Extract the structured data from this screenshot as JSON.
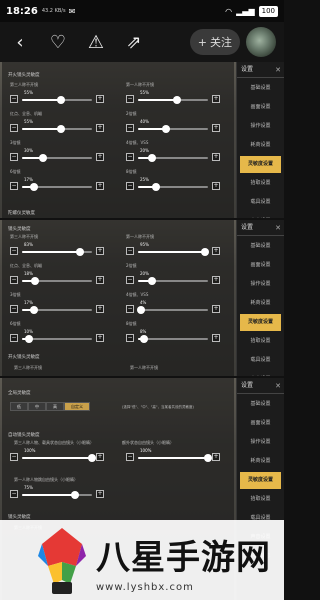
{
  "status": {
    "time": "18:26",
    "speed": "43.2 KB/s",
    "battery": "100"
  },
  "topbar": {
    "follow_label": "关注"
  },
  "sidebar": {
    "title": "设置",
    "items": [
      "基础设置",
      "画面设置",
      "操作设置",
      "耗商设置",
      "灵敏度设置",
      "拾取设置",
      "载具设置",
      "声音设置",
      "快速消息"
    ]
  },
  "panel1": {
    "section_a": "开火镜头灵敏度",
    "rows": [
      {
        "left": {
          "label": "第三人称不开镜",
          "pct": "55%",
          "value": 0.55
        },
        "right": {
          "label": "第一人称不开镜",
          "pct": "55%",
          "value": 0.55
        }
      },
      {
        "left": {
          "label": "红点、全息、机瞄",
          "pct": "55%",
          "value": 0.55
        },
        "right": {
          "label": "2倍镜",
          "pct": "40%",
          "value": 0.4
        }
      },
      {
        "left": {
          "label": "3倍镜",
          "pct": "30%",
          "value": 0.3
        },
        "right": {
          "label": "4倍镜、VSS",
          "pct": "20%",
          "value": 0.2
        }
      },
      {
        "left": {
          "label": "6倍镜",
          "pct": "17%",
          "value": 0.17
        },
        "right": {
          "label": "8倍镜",
          "pct": "25%",
          "value": 0.25
        }
      }
    ],
    "section_b": "陀螺仪灵敏度"
  },
  "panel2": {
    "section_a": "镜头灵敏度",
    "rows": [
      {
        "left": {
          "label": "第三人称不开镜",
          "pct": "83%",
          "value": 0.83
        },
        "right": {
          "label": "第一人称不开镜",
          "pct": "95%",
          "value": 0.95
        }
      },
      {
        "left": {
          "label": "红点、全息、机瞄",
          "pct": "18%",
          "value": 0.18
        },
        "right": {
          "label": "2倍镜",
          "pct": "20%",
          "value": 0.2
        }
      },
      {
        "left": {
          "label": "3倍镜",
          "pct": "17%",
          "value": 0.17
        },
        "right": {
          "label": "4倍镜、VSS",
          "pct": "4%",
          "value": 0.04
        }
      },
      {
        "left": {
          "label": "6倍镜",
          "pct": "10%",
          "value": 0.1
        },
        "right": {
          "label": "8倍镜",
          "pct": "8%",
          "value": 0.08
        }
      }
    ],
    "section_b": "开火镜头灵敏度",
    "row_b": {
      "left": "第三人称不开镜",
      "right": "第一人称不开镜"
    }
  },
  "panel3": {
    "section_a": "全局灵敏度",
    "segments": [
      "低",
      "中",
      "高",
      "自定义"
    ],
    "selected": "自定义",
    "note": "(选择\"低\"、\"中\"、\"高\"，当某者共设的灵敏度)",
    "section_b": "自动镜头灵敏度",
    "row1": {
      "left": {
        "label": "第三人称人物、载具状态自由镜头（小眼睛）",
        "pct": "100%",
        "value": 1.0
      },
      "right": {
        "label": "额外状态自由镜头（小眼睛）",
        "pct": "100%",
        "value": 1.0
      }
    },
    "row2": {
      "left": {
        "label": "第一人称人物跳自由镜头（小眼睛）",
        "pct": "75%",
        "value": 0.75
      }
    },
    "section_c": "镜头灵敏度",
    "row3": {
      "left": "第三人称不开镜"
    }
  },
  "watermark": {
    "title": "八星手游网",
    "url": "www.lyshbx.com"
  }
}
